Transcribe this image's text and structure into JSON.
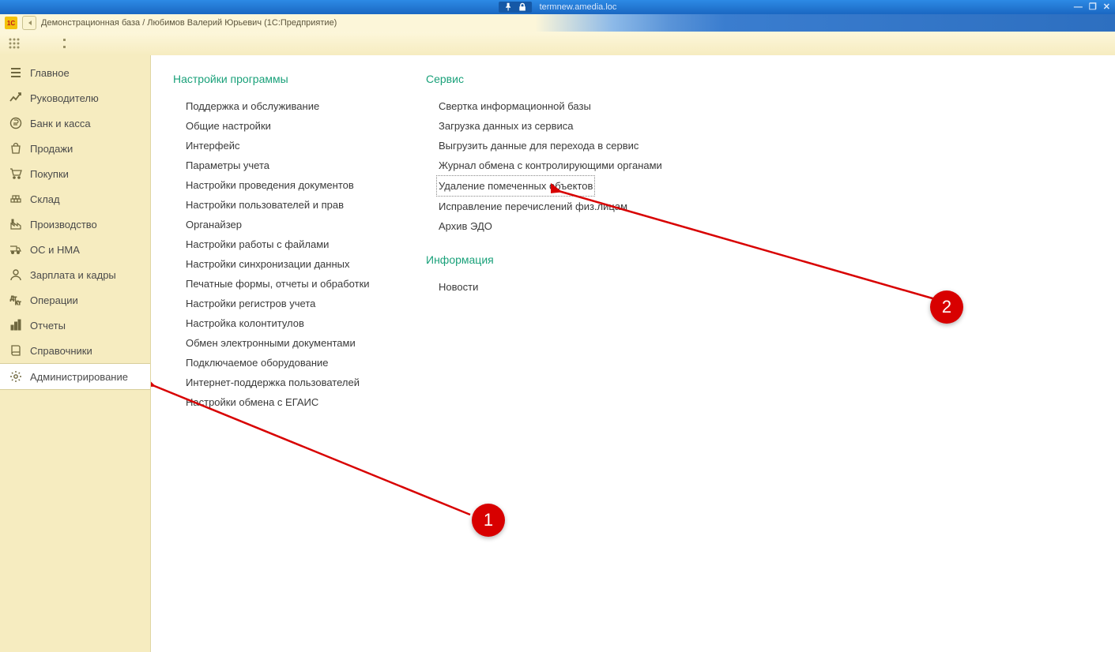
{
  "remote": {
    "host": "termnew.amedia.loc"
  },
  "window": {
    "title": "Демонстрационная база / Любимов Валерий Юрьевич  (1С:Предприятие)"
  },
  "sidebar": {
    "items": [
      {
        "label": "Главное",
        "icon": "menu"
      },
      {
        "label": "Руководителю",
        "icon": "trend"
      },
      {
        "label": "Банк и касса",
        "icon": "ruble"
      },
      {
        "label": "Продажи",
        "icon": "bag"
      },
      {
        "label": "Покупки",
        "icon": "cart"
      },
      {
        "label": "Склад",
        "icon": "warehouse"
      },
      {
        "label": "Производство",
        "icon": "factory"
      },
      {
        "label": "ОС и НМА",
        "icon": "truck"
      },
      {
        "label": "Зарплата и кадры",
        "icon": "person"
      },
      {
        "label": "Операции",
        "icon": "ops"
      },
      {
        "label": "Отчеты",
        "icon": "chart"
      },
      {
        "label": "Справочники",
        "icon": "book"
      },
      {
        "label": "Администрирование",
        "icon": "gear",
        "active": true
      }
    ]
  },
  "sections": {
    "settings": {
      "title": "Настройки программы",
      "links": [
        "Поддержка и обслуживание",
        "Общие настройки",
        "Интерфейс",
        "Параметры учета",
        "Настройки проведения документов",
        "Настройки пользователей и прав",
        "Органайзер",
        "Настройки работы с файлами",
        "Настройки синхронизации данных",
        "Печатные формы, отчеты и обработки",
        "Настройки регистров учета",
        "Настройка колонтитулов",
        "Обмен электронными документами",
        "Подключаемое оборудование",
        "Интернет-поддержка пользователей",
        "Настройки обмена с ЕГАИС"
      ]
    },
    "service": {
      "title": "Сервис",
      "links": [
        "Свертка информационной базы",
        "Загрузка данных из сервиса",
        "Выгрузить данные для перехода в сервис",
        "Журнал обмена с контролирующими органами",
        "Удаление помеченных объектов",
        "Исправление перечислений физ.лицам",
        "Архив ЭДО"
      ],
      "selected_index": 4
    },
    "info": {
      "title": "Информация",
      "links": [
        "Новости"
      ]
    }
  },
  "markers": {
    "one": "1",
    "two": "2"
  }
}
